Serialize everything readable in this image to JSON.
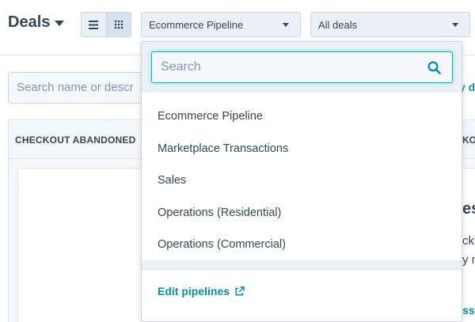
{
  "header": {
    "title": "Deals",
    "pipeline_select": "Ecommerce Pipeline",
    "deals_select": "All deals"
  },
  "background": {
    "search_placeholder": "Search name or descr",
    "link_fragment": "y d",
    "column_header": "CHECKOUT ABANDONED",
    "column_header_right": "KOU",
    "frag_heading": "ess",
    "frag_line1": "ck",
    "frag_line2": "y m",
    "frag_link": "ss i"
  },
  "dropdown": {
    "search_placeholder": "Search",
    "items": [
      "Ecommerce Pipeline",
      "Marketplace Transactions",
      "Sales",
      "Operations (Residential)",
      "Operations (Commercial)"
    ],
    "footer_link": "Edit pipelines"
  },
  "colors": {
    "accent": "#0091ae",
    "focus": "#00bda5",
    "text": "#33475b"
  }
}
